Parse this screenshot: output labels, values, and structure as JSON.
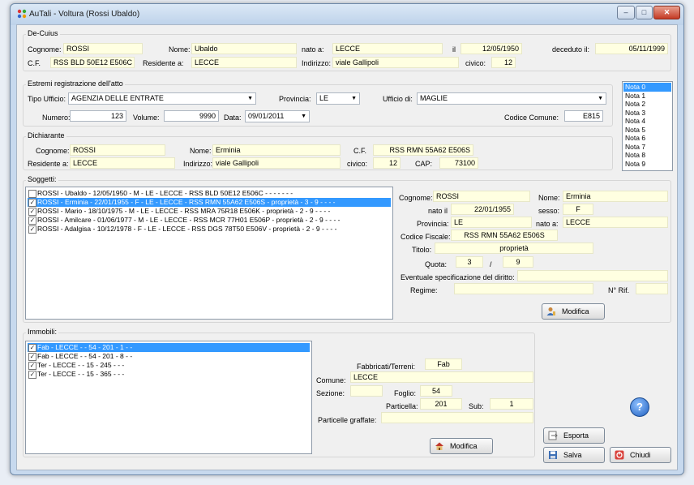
{
  "window": {
    "title": "AuTali - Voltura (Rossi Ubaldo)",
    "controls": {
      "minimize": "–",
      "maximize": "□",
      "close": "✕"
    }
  },
  "de_cuius": {
    "group_label": "De-Cuius",
    "cognome_label": "Cognome:",
    "cognome": "ROSSI",
    "nome_label": "Nome:",
    "nome": "Ubaldo",
    "nato_a_label": "nato a:",
    "nato_a": "LECCE",
    "il_label": "il",
    "il": "12/05/1950",
    "deceduto_label": "deceduto il:",
    "deceduto": "05/11/1999",
    "cf_label": "C.F.",
    "cf": "RSS BLD 50E12 E506C",
    "residente_label": "Residente a:",
    "residente": "LECCE",
    "indirizzo_label": "Indirizzo:",
    "indirizzo": "viale Gallipoli",
    "civico_label": "civico:",
    "civico": "12"
  },
  "estremi": {
    "group_label": "Estremi registrazione dell'atto",
    "tipo_ufficio_label": "Tipo Ufficio:",
    "tipo_ufficio": "AGENZIA DELLE ENTRATE",
    "provincia_label": "Provincia:",
    "provincia": "LE",
    "ufficio_label": "Ufficio di:",
    "ufficio": "MAGLIE",
    "numero_label": "Numero:",
    "numero": "123",
    "volume_label": "Volume:",
    "volume": "9990",
    "data_label": "Data:",
    "data": "09/01/2011",
    "codice_comune_label": "Codice Comune:",
    "codice_comune": "E815"
  },
  "note": [
    "Nota 0",
    "Nota 1",
    "Nota 2",
    "Nota 3",
    "Nota 4",
    "Nota 5",
    "Nota 6",
    "Nota 7",
    "Nota 8",
    "Nota 9"
  ],
  "dichiarante": {
    "group_label": "Dichiarante",
    "cognome_label": "Cognome:",
    "cognome": "ROSSI",
    "nome_label": "Nome:",
    "nome": "Erminia",
    "cf_label": "C.F.",
    "cf": "RSS RMN 55A62 E506S",
    "residente_label": "Residente a:",
    "residente": "LECCE",
    "indirizzo_label": "Indirizzo:",
    "indirizzo": "viale Gallipoli",
    "civico_label": "civico:",
    "civico": "12",
    "cap_label": "CAP:",
    "cap": "73100"
  },
  "soggetti": {
    "group_label": "Soggetti:",
    "items": [
      "ROSSI - Ubaldo - 12/05/1950 - M - LE - LECCE - RSS BLD 50E12 E506C - - - - - - -",
      "ROSSI - Erminia - 22/01/1955 - F - LE - LECCE - RSS RMN 55A62 E506S - proprietà - 3 - 9 - - - -",
      "ROSSI - Mario - 18/10/1975 - M - LE - LECCE - RSS MRA 75R18 E506K - proprietà - 2 - 9 - - - -",
      "ROSSI - Amilcare - 01/06/1977 - M - LE - LECCE - RSS MCR 77H01 E506P - proprietà - 2 - 9 - - - -",
      "ROSSI - Adalgisa - 10/12/1978 - F - LE - LECCE - RSS DGS 78T50 E506V - proprietà - 2 - 9 - - - -"
    ],
    "checked": [
      false,
      true,
      true,
      true,
      true
    ],
    "selected_index": 1,
    "detail": {
      "cognome_label": "Cognome:",
      "cognome": "ROSSI",
      "nome_label": "Nome:",
      "nome": "Erminia",
      "nato_il_label": "nato il",
      "nato_il": "22/01/1955",
      "sesso_label": "sesso:",
      "sesso": "F",
      "provincia_label": "Provincia:",
      "provincia": "LE",
      "nato_a_label": "nato a:",
      "nato_a": "LECCE",
      "cf_label": "Codice Fiscale:",
      "cf": "RSS RMN 55A62 E506S",
      "titolo_label": "Titolo:",
      "titolo": "proprietà",
      "quota_label": "Quota:",
      "quota_num": "3",
      "quota_sep": "/",
      "quota_den": "9",
      "spec_label": "Eventuale specificazione del diritto:",
      "spec": "",
      "regime_label": "Regime:",
      "regime": "",
      "nrif_label": "N° Rif.",
      "nrif": ""
    },
    "modifica_button": "Modifica"
  },
  "immobili": {
    "group_label": "Immobili:",
    "items": [
      "Fab - LECCE - - 54 - 201 - 1 - -",
      "Fab - LECCE - - 54 - 201 - 8 - -",
      "Ter - LECCE - - 15 - 245 - - -",
      "Ter - LECCE - - 15 - 365 - - -"
    ],
    "checked": [
      true,
      true,
      true,
      true
    ],
    "selected_index": 0,
    "detail": {
      "fabbricati_label": "Fabbricati/Terreni:",
      "fabbricati": "Fab",
      "comune_label": "Comune:",
      "comune": "LECCE",
      "sezione_label": "Sezione:",
      "sezione": "",
      "foglio_label": "Foglio:",
      "foglio": "54",
      "particella_label": "Particella:",
      "particella": "201",
      "sub_label": "Sub:",
      "sub": "1",
      "graffate_label": "Particelle graffate:",
      "graffate": ""
    },
    "modifica_button": "Modifica"
  },
  "buttons": {
    "esporta": "Esporta",
    "salva": "Salva",
    "chiudi": "Chiudi",
    "help": "?"
  },
  "colors": {
    "field_bg": "#ffffe1",
    "selection": "#3399ff",
    "window_frame": "#c7d9ee"
  }
}
